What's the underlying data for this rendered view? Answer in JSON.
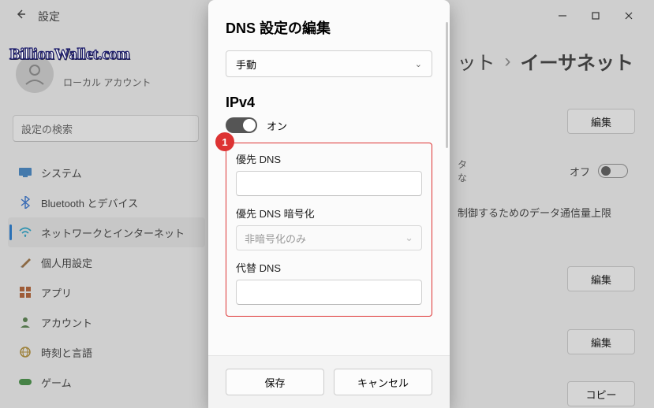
{
  "window": {
    "app_title": "設定"
  },
  "watermark": "BillionWallet.com",
  "account": {
    "subtitle": "ローカル アカウント"
  },
  "search": {
    "placeholder": "設定の検索"
  },
  "sidebar": {
    "items": [
      {
        "icon": "monitor",
        "label": "システム",
        "color": "#3b82c4"
      },
      {
        "icon": "bluetooth",
        "label": "Bluetooth とデバイス",
        "color": "#2d6fd1"
      },
      {
        "icon": "wifi",
        "label": "ネットワークとインターネット",
        "color": "#18a0c9",
        "active": true
      },
      {
        "icon": "brush",
        "label": "個人用設定",
        "color": "#6b6b6b"
      },
      {
        "icon": "apps",
        "label": "アプリ",
        "color": "#b25a2a"
      },
      {
        "icon": "person",
        "label": "アカウント",
        "color": "#4f7d44"
      },
      {
        "icon": "globe",
        "label": "時刻と言語",
        "color": "#b08a2a"
      },
      {
        "icon": "game",
        "label": "ゲーム",
        "color": "#3c8c3c"
      }
    ]
  },
  "breadcrumb": {
    "segment1": "ット",
    "separator": "›",
    "segment2": "イーサネット"
  },
  "right": {
    "frag1": "タ",
    "frag2": "な",
    "off_label": "オフ",
    "limit_text": "制御するためのデータ通信量上限",
    "btn_edit": "編集",
    "btn_copy": "コピー"
  },
  "dialog": {
    "title": "DNS 設定の編集",
    "mode_value": "手動",
    "ipv4_title": "IPv4",
    "ipv4_toggle_label": "オン",
    "badge": "1",
    "field_pref_dns": "優先 DNS",
    "field_pref_enc": "優先 DNS 暗号化",
    "enc_value": "非暗号化のみ",
    "field_alt_dns": "代替 DNS",
    "save": "保存",
    "cancel": "キャンセル"
  }
}
